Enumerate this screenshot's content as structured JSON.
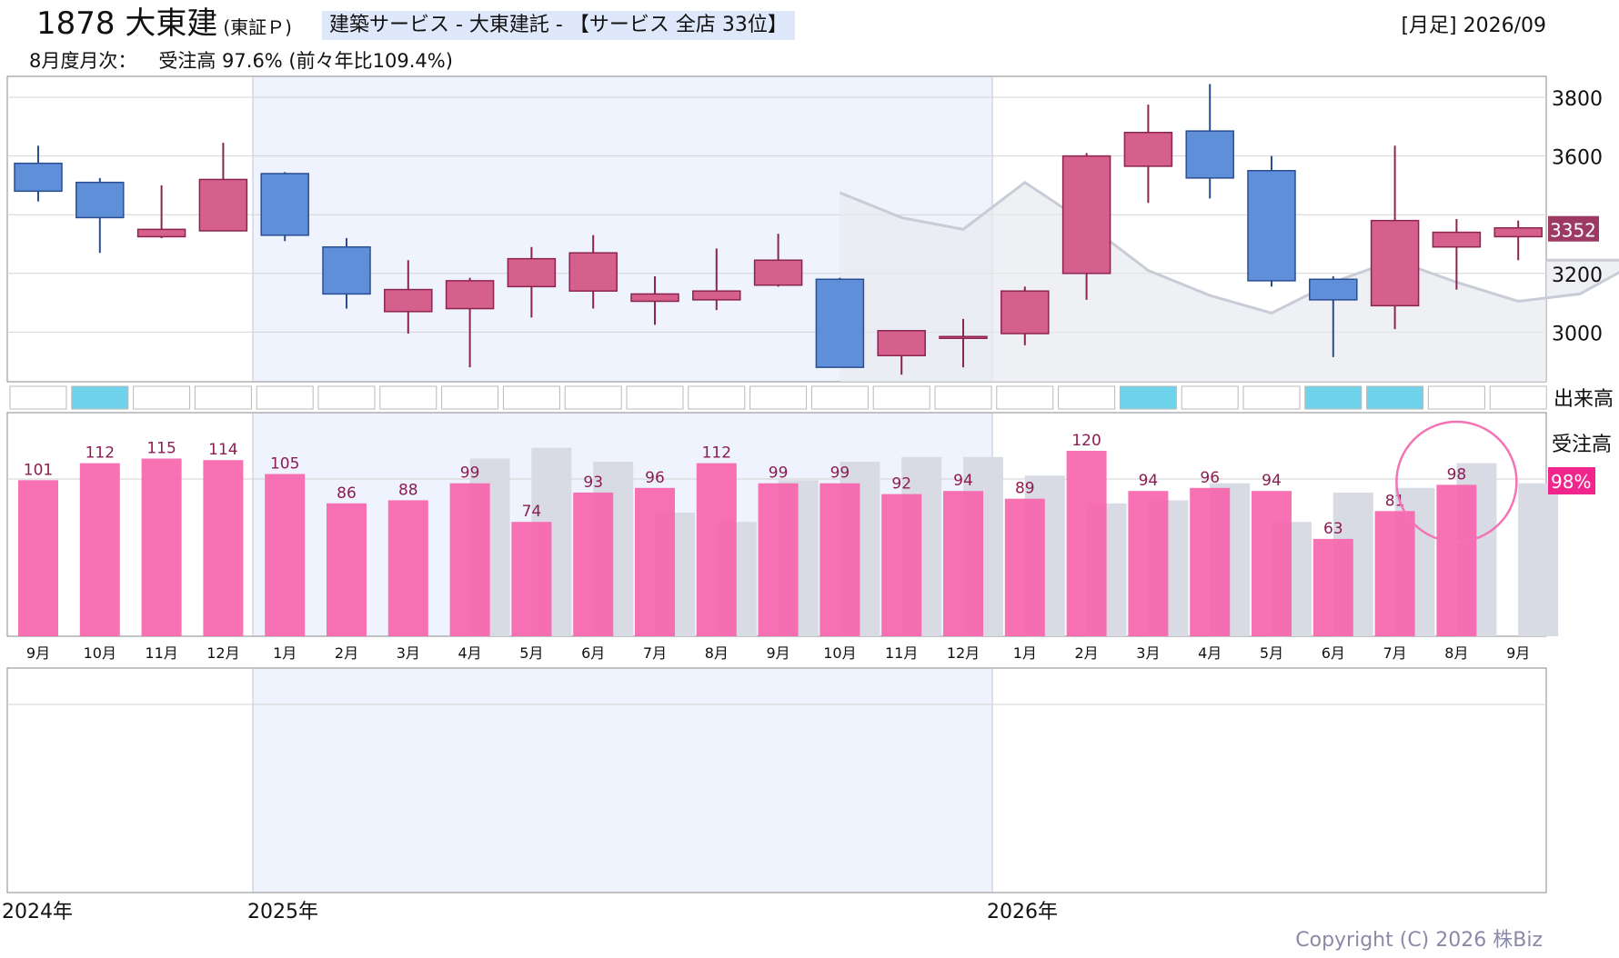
{
  "header": {
    "code": "1878",
    "name": "大東建",
    "exchange": "(東証Ｐ)",
    "sector": "建築サービス - 大東建託 - 【サービス 全店 33位】",
    "period": "[月足] 2026/09",
    "monthly_label": "8月度月次：",
    "monthly_value": "受注高 97.6% (前々年比109.4%)"
  },
  "copyright": "Copyright (C) 2026 株Biz",
  "colors": {
    "up": "#d5608c",
    "down": "#5f8fd8",
    "bar": "#f765ac",
    "bar_prev": "#d8dbe4",
    "shade": "#eef3fd",
    "price_badge": "#9c3a64",
    "pct_badge": "#f0268d",
    "volume_cell_active": "#6fd3ec"
  },
  "chart_data": [
    {
      "type": "candlestick",
      "x": [
        "2024-09",
        "2024-10",
        "2024-11",
        "2024-12",
        "2025-01",
        "2025-02",
        "2025-03",
        "2025-04",
        "2025-05",
        "2025-06",
        "2025-07",
        "2025-08",
        "2025-09",
        "2025-10",
        "2025-11",
        "2025-12",
        "2026-01",
        "2026-02",
        "2026-03",
        "2026-04",
        "2026-05",
        "2026-06",
        "2026-07",
        "2026-08",
        "2026-09"
      ],
      "ohlc": [
        [
          3575,
          3635,
          3445,
          3480
        ],
        [
          3510,
          3525,
          3270,
          3390
        ],
        [
          3325,
          3500,
          3320,
          3350
        ],
        [
          3345,
          3645,
          3345,
          3520
        ],
        [
          3540,
          3545,
          3310,
          3330
        ],
        [
          3290,
          3320,
          3080,
          3130
        ],
        [
          3070,
          3245,
          2995,
          3145
        ],
        [
          3080,
          3185,
          2880,
          3175
        ],
        [
          3155,
          3290,
          3050,
          3250
        ],
        [
          3140,
          3330,
          3080,
          3270
        ],
        [
          3105,
          3190,
          3025,
          3130
        ],
        [
          3110,
          3285,
          3075,
          3140
        ],
        [
          3160,
          3335,
          3155,
          3245
        ],
        [
          3180,
          3185,
          2880,
          2880
        ],
        [
          2920,
          2960,
          2855,
          3005
        ],
        [
          2985,
          3045,
          2880,
          2985
        ],
        [
          2995,
          3155,
          2955,
          3140
        ],
        [
          3200,
          3610,
          3110,
          3600
        ],
        [
          3565,
          3775,
          3440,
          3680
        ],
        [
          3685,
          3845,
          3455,
          3525
        ],
        [
          3550,
          3600,
          3155,
          3175
        ],
        [
          3180,
          3190,
          2915,
          3110
        ],
        [
          3090,
          3635,
          3010,
          3380
        ],
        [
          3290,
          3385,
          3145,
          3340
        ],
        [
          3325,
          3380,
          3245,
          3355
        ]
      ],
      "overlay_line": {
        "start_index": 13,
        "values": [
          3475,
          3390,
          3350,
          3510,
          3370,
          3210,
          3125,
          3065,
          3170,
          3245,
          3170,
          3105,
          3130,
          3245
        ]
      },
      "ylim": [
        2830,
        3870
      ],
      "yticks": [
        "3000",
        "3200",
        "3400",
        "3600",
        "3800"
      ],
      "last_price": "3352"
    },
    {
      "type": "volume-strip",
      "label": "出来高",
      "active": [
        false,
        true,
        false,
        false,
        false,
        false,
        false,
        false,
        false,
        false,
        false,
        false,
        false,
        false,
        false,
        false,
        false,
        false,
        true,
        false,
        false,
        true,
        true,
        false,
        false
      ]
    },
    {
      "type": "bar",
      "label": "受注高",
      "categories": [
        "9月",
        "10月",
        "11月",
        "12月",
        "1月",
        "2月",
        "3月",
        "4月",
        "5月",
        "6月",
        "7月",
        "8月",
        "9月",
        "10月",
        "11月",
        "12月",
        "1月",
        "2月",
        "3月",
        "4月",
        "5月",
        "6月",
        "7月",
        "8月",
        "9月"
      ],
      "series": [
        {
          "values": [
            101,
            112,
            115,
            114,
            105,
            86,
            88,
            99,
            74,
            93,
            96,
            112,
            99,
            99,
            92,
            94,
            89,
            120,
            94,
            96,
            94,
            63,
            81,
            98,
            null
          ]
        },
        {
          "values": [
            null,
            null,
            null,
            null,
            null,
            null,
            null,
            115,
            122,
            113,
            80,
            74,
            101,
            113,
            116,
            116,
            104,
            86,
            88,
            99,
            74,
            93,
            96,
            112,
            99
          ]
        }
      ],
      "labels": [
        "101",
        "112",
        "115",
        "114",
        "105",
        "86",
        "88",
        "99",
        "74",
        "93",
        "96",
        "112",
        "99",
        "99",
        "92",
        "94",
        "89",
        "120",
        "94",
        "96",
        "94",
        "63",
        "81",
        "98",
        ""
      ],
      "ylim": [
        0,
        140
      ],
      "reference": 100,
      "current_pct": "98%",
      "highlight_index": 23
    }
  ],
  "years": [
    "2024年",
    "2025年",
    "2026年"
  ]
}
